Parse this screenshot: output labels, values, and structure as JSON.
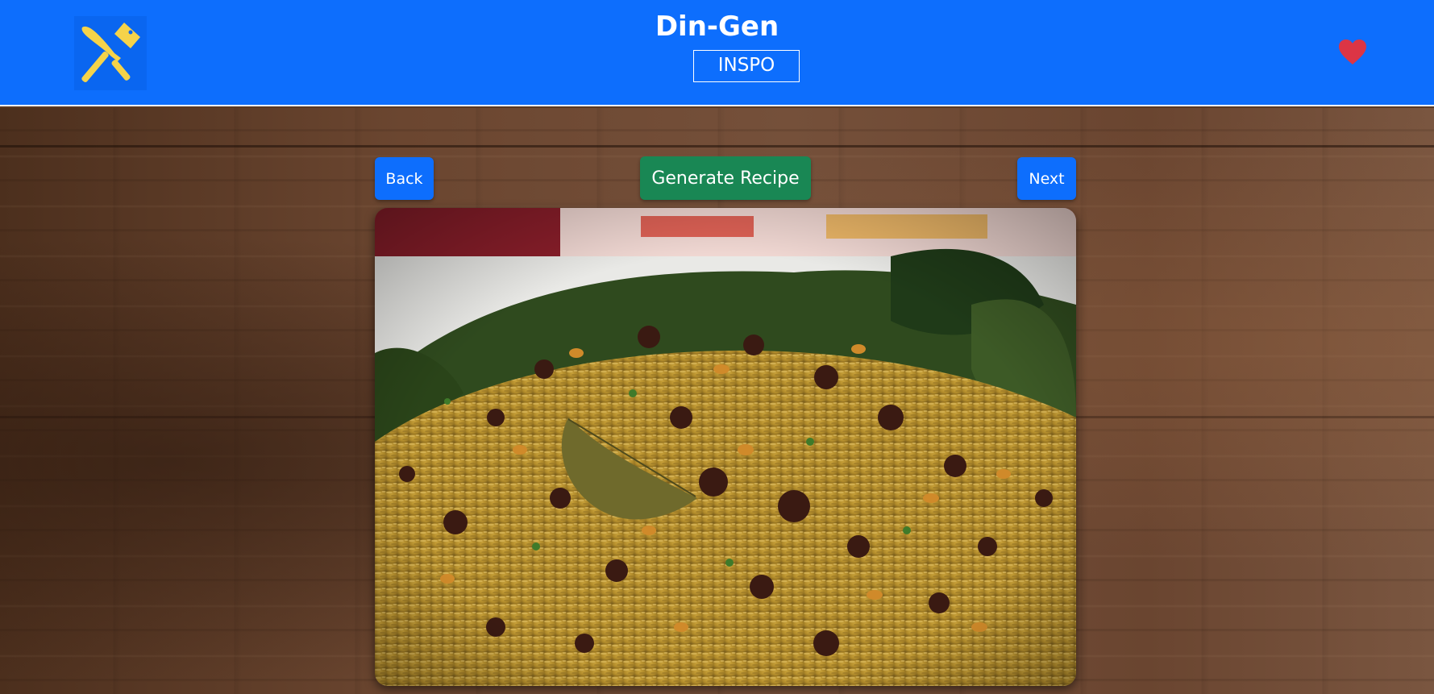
{
  "header": {
    "app_title": "Din-Gen",
    "subtitle": "INSPO",
    "logo_icon": "crossed-knives-icon",
    "favorites_icon": "heart-icon",
    "background_color": "#0d6efd",
    "logo_color": "#f5d34a",
    "heart_color": "#dc3545"
  },
  "controls": {
    "back_label": "Back",
    "generate_label": "Generate Recipe",
    "next_label": "Next",
    "primary_color": "#0d6efd",
    "success_color": "#198754"
  },
  "main": {
    "background": "wood-texture",
    "image": {
      "kind": "food-photo",
      "subject": "rice-dish"
    }
  }
}
